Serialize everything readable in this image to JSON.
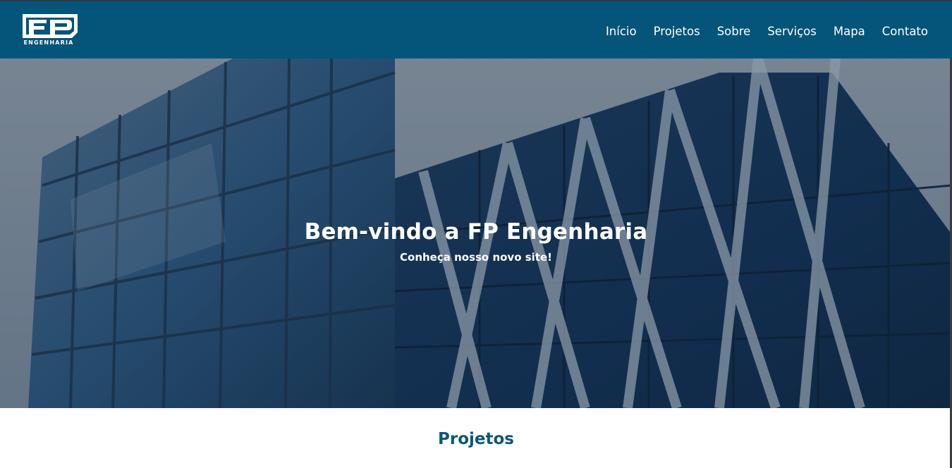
{
  "header": {
    "logo_text": "FP",
    "logo_caption": "ENGENHARIA",
    "nav": [
      {
        "label": "Início"
      },
      {
        "label": "Projetos"
      },
      {
        "label": "Sobre"
      },
      {
        "label": "Serviços"
      },
      {
        "label": "Mapa"
      },
      {
        "label": "Contato"
      }
    ]
  },
  "hero": {
    "title": "Bem-vindo a FP Engenharia",
    "subtitle": "Conheça nosso novo site!"
  },
  "projects_section": {
    "title": "Projetos"
  },
  "colors": {
    "navbar": "#045579",
    "section_title": "#0d5776",
    "hero_overlay": "#16283a"
  }
}
